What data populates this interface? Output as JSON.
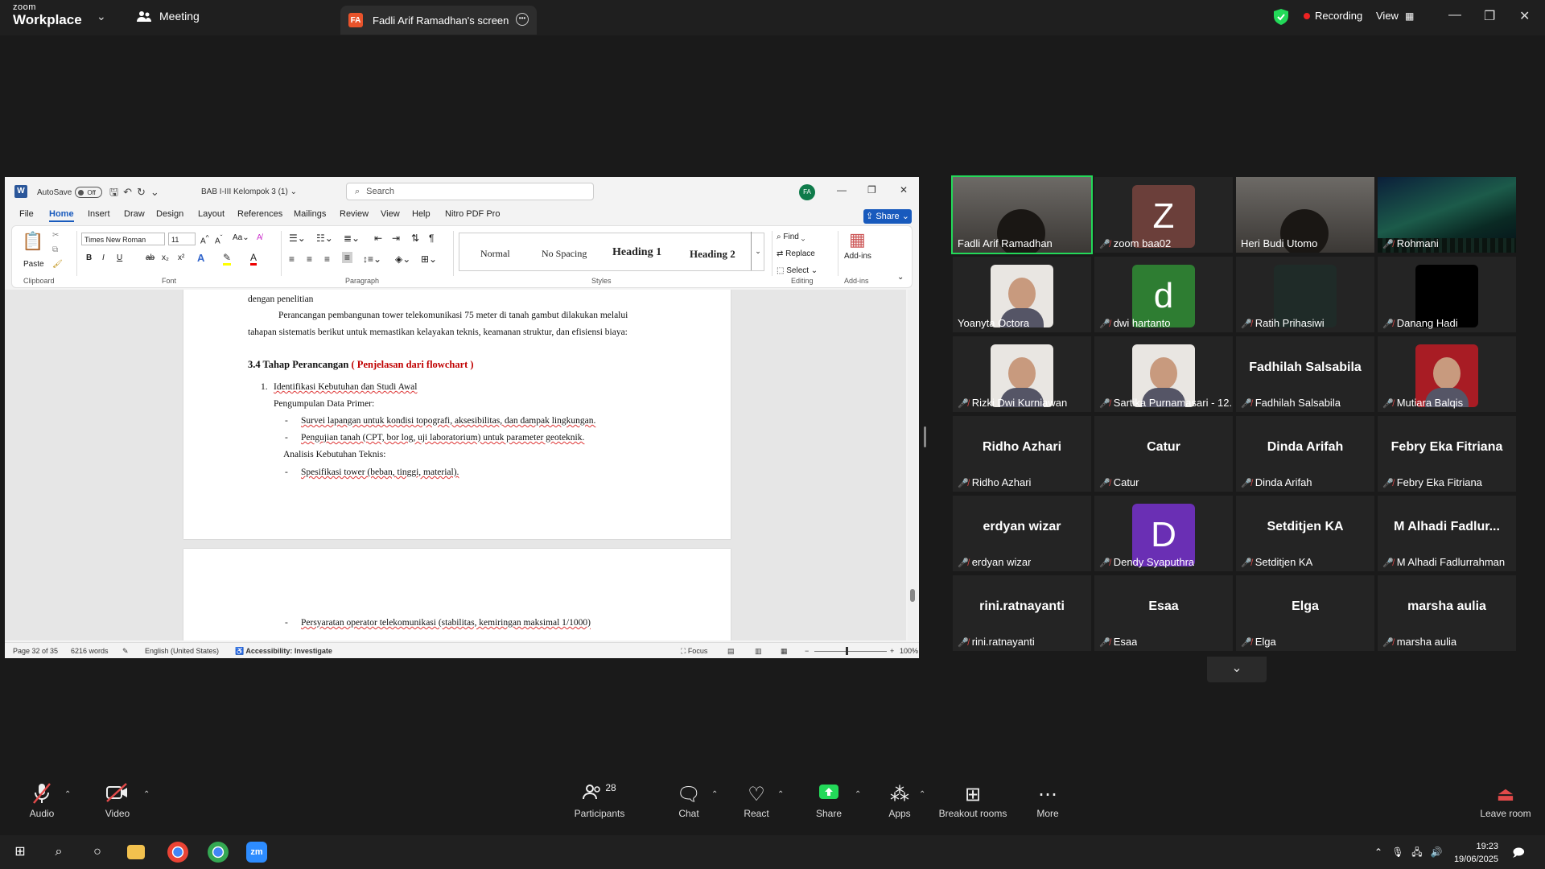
{
  "zoom": {
    "logo_line1": "zoom",
    "logo_line2": "Workplace",
    "meeting_label": "Meeting",
    "share_tab": {
      "initials": "FA",
      "label": "Fadli Arif Ramadhan's screen"
    },
    "recording_label": "Recording",
    "view_label": "View"
  },
  "word": {
    "autosave_label": "AutoSave",
    "autosave_state": "Off",
    "doc_title": "BAB I-III Kelompok 3 (1)",
    "search_placeholder": "Search",
    "avatar_initials": "FA",
    "tabs": [
      "File",
      "Home",
      "Insert",
      "Draw",
      "Design",
      "Layout",
      "References",
      "Mailings",
      "Review",
      "View",
      "Help",
      "Nitro PDF Pro"
    ],
    "share_label": "Share",
    "ribbon": {
      "paste": "Paste",
      "clipboard": "Clipboard",
      "font_name": "Times New Roman",
      "font_size": "11",
      "font_group": "Font",
      "paragraph_group": "Paragraph",
      "styles": [
        "Normal",
        "No Spacing",
        "Heading 1",
        "Heading 2"
      ],
      "styles_group": "Styles",
      "find": "Find",
      "replace": "Replace",
      "select": "Select",
      "editing_group": "Editing",
      "addins": "Add-ins",
      "addins_group": "Add-ins"
    },
    "doc": {
      "line0": "dengan penelitian",
      "para1": "Perancangan pembangunan tower telekomunikasi 75 meter di tanah gambut dilakukan melalui",
      "para2": "tahapan sistematis berikut untuk memastikan kelayakan teknis, keamanan struktur, dan efisiensi biaya:",
      "heading_black": "3.4 Tahap Perancangan ",
      "heading_red": "( Penjelasan dari flowchart )",
      "item1_num": "1.",
      "item1": "Identifikasi Kebutuhan dan Studi Awal",
      "sub1": "Pengumpulan Data Primer:",
      "bullet1": "Survei lapangan untuk kondisi topografi, aksesibilitas, dan dampak lingkungan.",
      "bullet2": "Pengujian tanah (CPT, bor log, uji laboratorium) untuk parameter geoteknik.",
      "sub2": "Analisis Kebutuhan Teknis:",
      "bullet3": "Spesifikasi tower (beban, tinggi, material).",
      "bullet4": "Persyaratan operator telekomunikasi (stabilitas, kemiringan maksimal 1/1000)",
      "dash": "-"
    },
    "status": {
      "page": "Page 32 of 35",
      "words": "6216 words",
      "language": "English (United States)",
      "accessibility": "Accessibility: Investigate",
      "focus": "Focus",
      "zoom": "100%"
    }
  },
  "participants": [
    {
      "name": "Fadli Arif Ramadhan",
      "muted": false,
      "kind": "video",
      "active": true
    },
    {
      "name": "zoom baa02",
      "muted": true,
      "kind": "letter",
      "letter": "Z",
      "color": "#6b3f3a"
    },
    {
      "name": "Heri Budi Utomo",
      "muted": false,
      "kind": "video"
    },
    {
      "name": "Rohmani",
      "muted": true,
      "kind": "aurora"
    },
    {
      "name": "Yoanyta Octora",
      "muted": false,
      "kind": "photo"
    },
    {
      "name": "dwi hartanto",
      "muted": true,
      "kind": "letter",
      "letter": "d",
      "color": "#2e7d32"
    },
    {
      "name": "Ratih Prihasiwi",
      "muted": true,
      "kind": "dark"
    },
    {
      "name": "Danang Hadi",
      "muted": true,
      "kind": "black"
    },
    {
      "name": "Rizki Dwi Kurniawan",
      "muted": true,
      "kind": "photo"
    },
    {
      "name": "Sartika Purnamasari - 12...",
      "muted": true,
      "kind": "photo"
    },
    {
      "name": "Fadhilah Salsabila",
      "muted": true,
      "kind": "text",
      "big": "Fadhilah Salsabila"
    },
    {
      "name": "Mutiara Balqis",
      "muted": true,
      "kind": "photo_red"
    },
    {
      "name": "Ridho Azhari",
      "muted": true,
      "kind": "text",
      "big": "Ridho Azhari"
    },
    {
      "name": "Catur",
      "muted": true,
      "kind": "text",
      "big": "Catur"
    },
    {
      "name": "Dinda Arifah",
      "muted": true,
      "kind": "text",
      "big": "Dinda Arifah"
    },
    {
      "name": "Febry Eka Fitriana",
      "muted": true,
      "kind": "text",
      "big": "Febry Eka Fitriana"
    },
    {
      "name": "erdyan wizar",
      "muted": true,
      "kind": "text",
      "big": "erdyan wizar"
    },
    {
      "name": "Dendy Syaputhra",
      "muted": true,
      "kind": "letter",
      "letter": "D",
      "color": "#6a2fb4"
    },
    {
      "name": "Setditjen KA",
      "muted": true,
      "kind": "text",
      "big": "Setditjen KA"
    },
    {
      "name": "M Alhadi Fadlurrahman",
      "muted": true,
      "kind": "text",
      "big": "M Alhadi Fadlur..."
    },
    {
      "name": "rini.ratnayanti",
      "muted": true,
      "kind": "text",
      "big": "rini.ratnayanti"
    },
    {
      "name": "Esaa",
      "muted": true,
      "kind": "text",
      "big": "Esaa"
    },
    {
      "name": "Elga",
      "muted": true,
      "kind": "text",
      "big": "Elga"
    },
    {
      "name": "marsha aulia",
      "muted": true,
      "kind": "text",
      "big": "marsha aulia"
    }
  ],
  "toolbar": {
    "audio": "Audio",
    "video": "Video",
    "participants": "Participants",
    "participants_count": "28",
    "chat": "Chat",
    "react": "React",
    "share": "Share",
    "apps": "Apps",
    "breakout": "Breakout rooms",
    "more": "More",
    "leave": "Leave room"
  },
  "taskbar": {
    "time": "19:23",
    "date": "19/06/2025"
  },
  "colors": {
    "zoom_green": "#23d959",
    "word_blue": "#185abd",
    "heading_red": "#c00000",
    "mute_red": "#e24a4a"
  }
}
